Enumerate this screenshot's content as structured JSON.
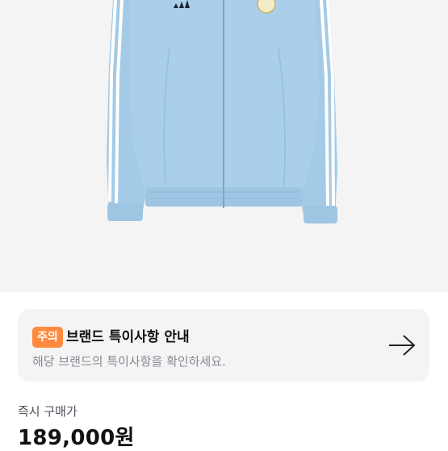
{
  "product_image": {
    "alt": "light blue track jacket"
  },
  "notice": {
    "badge": "주의",
    "title": "브랜드 특이사항 안내",
    "subtitle": "해당 브랜드의 특이사항을 확인하세요.",
    "icon": "arrow-right-icon"
  },
  "price": {
    "label": "즉시 구매가",
    "value": "189,000원"
  },
  "colors": {
    "jacket": "#a9cfea",
    "badge": "#ff8a3d",
    "card_bg": "#f4f4f5"
  }
}
